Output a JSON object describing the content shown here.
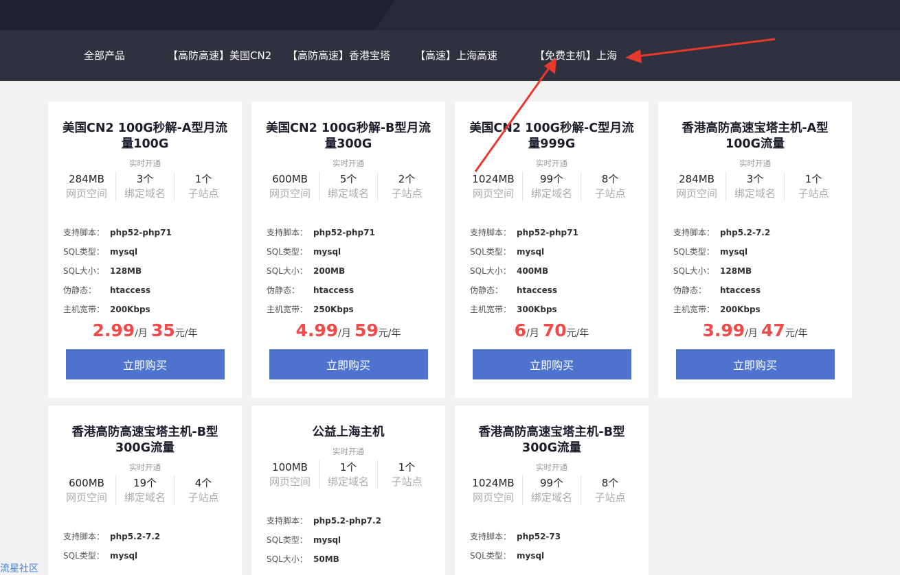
{
  "nav": {
    "items": [
      {
        "label": "全部产品"
      },
      {
        "label": "【高防高速】美国CN2"
      },
      {
        "label": "【高防高速】香港宝塔"
      },
      {
        "label": "【高速】上海高速"
      },
      {
        "label": "【免费主机】上海"
      }
    ]
  },
  "spec_labels": {
    "script": "支持脚本：",
    "sql_type": "SQL类型：",
    "sql_size": "SQL大小：",
    "rewrite": "伪静态：",
    "bandwidth": "主机宽带："
  },
  "price_units": {
    "month": "/月",
    "year": "元/年"
  },
  "cards": [
    {
      "title": "美国CN2 100G秒解-A型月流量100G",
      "subtitle": "实时开通",
      "stats": [
        {
          "value": "284MB",
          "label": "网页空间"
        },
        {
          "value": "3个",
          "label": "绑定域名"
        },
        {
          "value": "1个",
          "label": "子站点"
        }
      ],
      "specs": {
        "script": "php52-php71",
        "sql_type": "mysql",
        "sql_size": "128MB",
        "rewrite": "htaccess",
        "bandwidth": "200Kbps"
      },
      "price_month": "2.99",
      "price_year": "35",
      "buy_label": "立即购买"
    },
    {
      "title": "美国CN2 100G秒解-B型月流量300G",
      "subtitle": "实时开通",
      "stats": [
        {
          "value": "600MB",
          "label": "网页空间"
        },
        {
          "value": "5个",
          "label": "绑定域名"
        },
        {
          "value": "2个",
          "label": "子站点"
        }
      ],
      "specs": {
        "script": "php52-php71",
        "sql_type": "mysql",
        "sql_size": "200MB",
        "rewrite": "htaccess",
        "bandwidth": "250Kbps"
      },
      "price_month": "4.99",
      "price_year": "59",
      "buy_label": "立即购买"
    },
    {
      "title": "美国CN2 100G秒解-C型月流量999G",
      "subtitle": "实时开通",
      "stats": [
        {
          "value": "1024MB",
          "label": "网页空间"
        },
        {
          "value": "99个",
          "label": "绑定域名"
        },
        {
          "value": "8个",
          "label": "子站点"
        }
      ],
      "specs": {
        "script": "php52-php71",
        "sql_type": "mysql",
        "sql_size": "400MB",
        "rewrite": "htaccess",
        "bandwidth": "300Kbps"
      },
      "price_month": "6",
      "price_year": "70",
      "buy_label": "立即购买"
    },
    {
      "title": "香港高防高速宝塔主机-A型100G流量",
      "subtitle": "实时开通",
      "stats": [
        {
          "value": "284MB",
          "label": "网页空间"
        },
        {
          "value": "3个",
          "label": "绑定域名"
        },
        {
          "value": "1个",
          "label": "子站点"
        }
      ],
      "specs": {
        "script": "php5.2-7.2",
        "sql_type": "mysql",
        "sql_size": "128MB",
        "rewrite": "htaccess",
        "bandwidth": "200Kbps"
      },
      "price_month": "3.99",
      "price_year": "47",
      "buy_label": "立即购买"
    },
    {
      "title": "香港高防高速宝塔主机-B型300G流量",
      "subtitle": "实时开通",
      "stats": [
        {
          "value": "600MB",
          "label": "网页空间"
        },
        {
          "value": "19个",
          "label": "绑定域名"
        },
        {
          "value": "4个",
          "label": "子站点"
        }
      ],
      "specs": {
        "script": "php5.2-7.2",
        "sql_type": "mysql"
      }
    },
    {
      "title": "公益上海主机",
      "subtitle": "实时开通",
      "stats": [
        {
          "value": "100MB",
          "label": "网页空间"
        },
        {
          "value": "1个",
          "label": "绑定域名"
        },
        {
          "value": "1个",
          "label": "子站点"
        }
      ],
      "specs": {
        "script": "php5.2-php7.2",
        "sql_type": "mysql",
        "sql_size": "50MB"
      }
    },
    {
      "title": "香港高防高速宝塔主机-B型300G流量",
      "subtitle": "实时开通",
      "stats": [
        {
          "value": "1024MB",
          "label": "网页空间"
        },
        {
          "value": "99个",
          "label": "绑定域名"
        },
        {
          "value": "8个",
          "label": "子站点"
        }
      ],
      "specs": {
        "script": "php52-73",
        "sql_type": "mysql"
      }
    }
  ],
  "watermark": "流星社区",
  "annotation_color": "#e8392f"
}
